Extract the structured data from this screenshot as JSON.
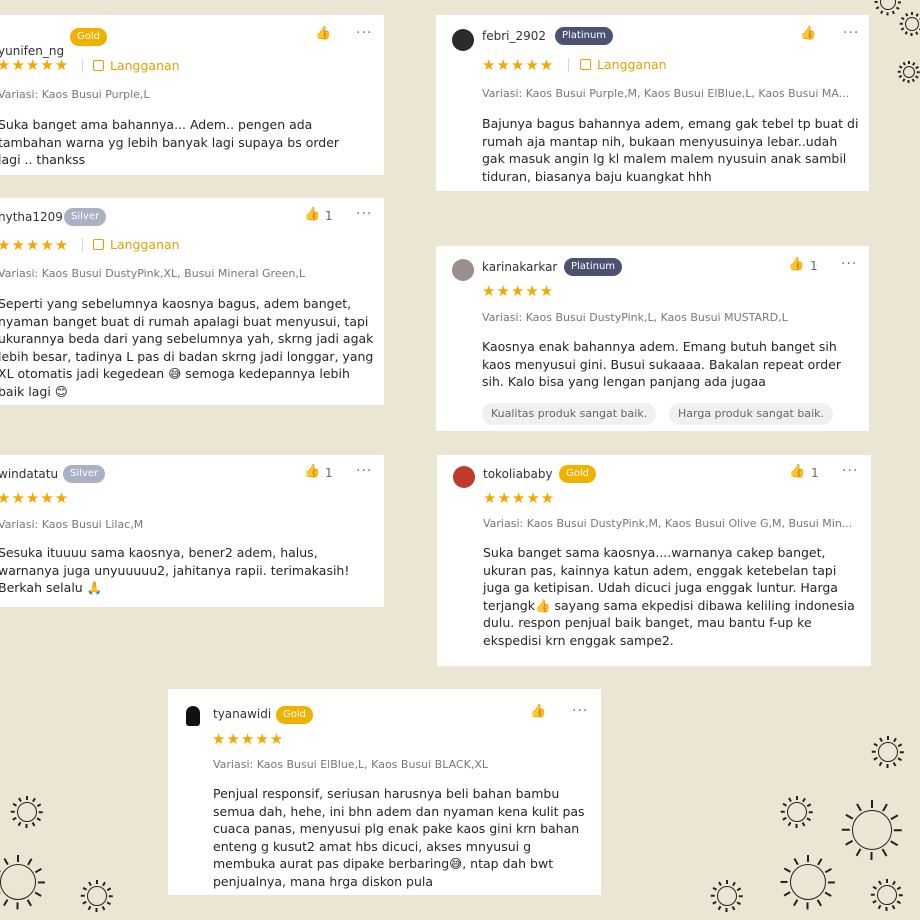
{
  "stars": "★★★★★",
  "more_label": "···",
  "like_glyph": "👍",
  "colors": {
    "background": "#ebe6d3",
    "star": "#f7a600",
    "gold": "#f0b100",
    "silver": "#aab1c4",
    "platinum": "#4b5373"
  },
  "reviews": [
    {
      "user": "yunifen_ng",
      "badge": "Gold",
      "likes": "",
      "subscription": "Langganan",
      "variant": "Variasi: Kaos Busui Purple,L",
      "text": "Suka banget ama bahannya... Adem.. pengen ada tambahan warna yg lebih banyak lagi supaya bs order lagi .. thankss"
    },
    {
      "user": "febri_2902",
      "badge": "Platinum",
      "likes": "",
      "subscription": "Langganan",
      "variant": "Variasi: Kaos Busui Purple,M, Kaos Busui ElBlue,L, Kaos Busui MA...",
      "text": "Bajunya bagus bahannya adem, emang gak tebel tp buat di rumah aja mantap nih, bukaan menyusuinya lebar..udah gak masuk angin lg kl malem malem nyusuin anak sambil tiduran, biasanya baju kuangkat hhh"
    },
    {
      "user": "nytha1209",
      "badge": "Silver",
      "likes": "1",
      "subscription": "Langganan",
      "variant": "Variasi: Kaos Busui DustyPink,XL, Busui Mineral Green,L",
      "text": "Seperti yang sebelumnya kaosnya bagus, adem banget, nyaman banget buat di rumah apalagi buat menyusui, tapi ukurannya beda dari yang sebelumnya yah, skrng jadi agak lebih besar, tadinya L pas di badan skrng jadi longgar, yang XL otomatis jadi kegedean 😅 semoga kedepannya lebih baik lagi 😊"
    },
    {
      "user": "karinakarkar",
      "badge": "Platinum",
      "likes": "1",
      "variant": "Variasi: Kaos Busui DustyPink,L, Kaos Busui MUSTARD,L",
      "text": "Kaosnya enak bahannya adem. Emang butuh banget sih kaos menyusui gini. Busui sukaaaa. Bakalan repeat order sih. Kalo bisa yang lengan panjang ada jugaa",
      "tags": [
        "Kualitas produk sangat baik.",
        "Harga produk sangat baik."
      ]
    },
    {
      "user": "windatatu",
      "badge": "Silver",
      "likes": "1",
      "variant": "Variasi: Kaos Busui Lilac,M",
      "text": "Sesuka ituuuu sama kaosnya, bener2 adem, halus, warnanya juga unyuuuuu2, jahitanya rapii. terimakasih! Berkah selalu 🙏"
    },
    {
      "user": "tokoliababy",
      "badge": "Gold",
      "likes": "1",
      "variant": "Variasi: Kaos Busui DustyPink,M, Kaos Busui Olive G,M, Busui Min...",
      "text": "Suka banget sama kaosnya....warnanya cakep banget, ukuran pas, kainnya katun adem, enggak ketebelan tapi juga ga ketipisan. Udah dicuci juga enggak luntur. Harga terjangk👍 sayang sama ekpedisi dibawa keliling indonesia dulu. respon penjual baik banget, mau bantu f-up ke ekspedisi krn enggak sampe2."
    },
    {
      "user": "tyanawidi",
      "badge": "Gold",
      "likes": "",
      "variant": "Variasi: Kaos Busui ElBlue,L, Kaos Busui BLACK,XL",
      "text": "Penjual responsif, seriusan harusnya beli bahan bambu semua dah, hehe, ini bhn adem dan nyaman kena kulit pas cuaca panas, menyusui plg enak pake kaos gini krn bahan enteng g kusut2 amat hbs dicuci, akses mnyusui g membuka aurat pas dipake berbaring😅, ntap dah bwt penjualnya, mana hrga diskon pula"
    }
  ]
}
